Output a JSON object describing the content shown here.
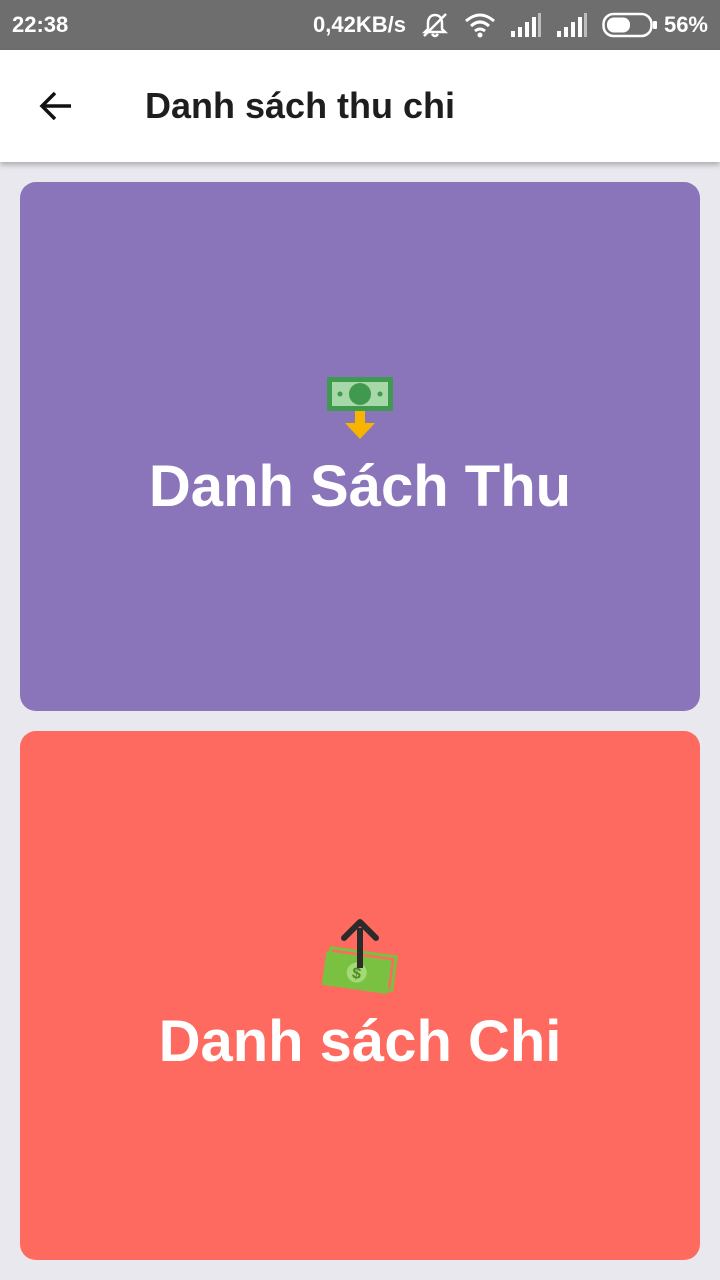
{
  "status_bar": {
    "time": "22:38",
    "network_speed": "0,42KB/s",
    "battery_percent": "56%",
    "battery_level": 0.56,
    "icons": [
      "mute-icon",
      "wifi-icon",
      "signal-icon",
      "signal-icon",
      "battery-icon"
    ]
  },
  "app_bar": {
    "title": "Danh sách thu chi",
    "back_icon": "arrow-left-icon"
  },
  "cards": {
    "income": {
      "label": "Danh Sách Thu",
      "icon": "money-in-icon",
      "color": "#8a75ba"
    },
    "expense": {
      "label": "Danh sách Chi",
      "icon": "money-out-icon",
      "color": "#fe6a5f"
    }
  }
}
